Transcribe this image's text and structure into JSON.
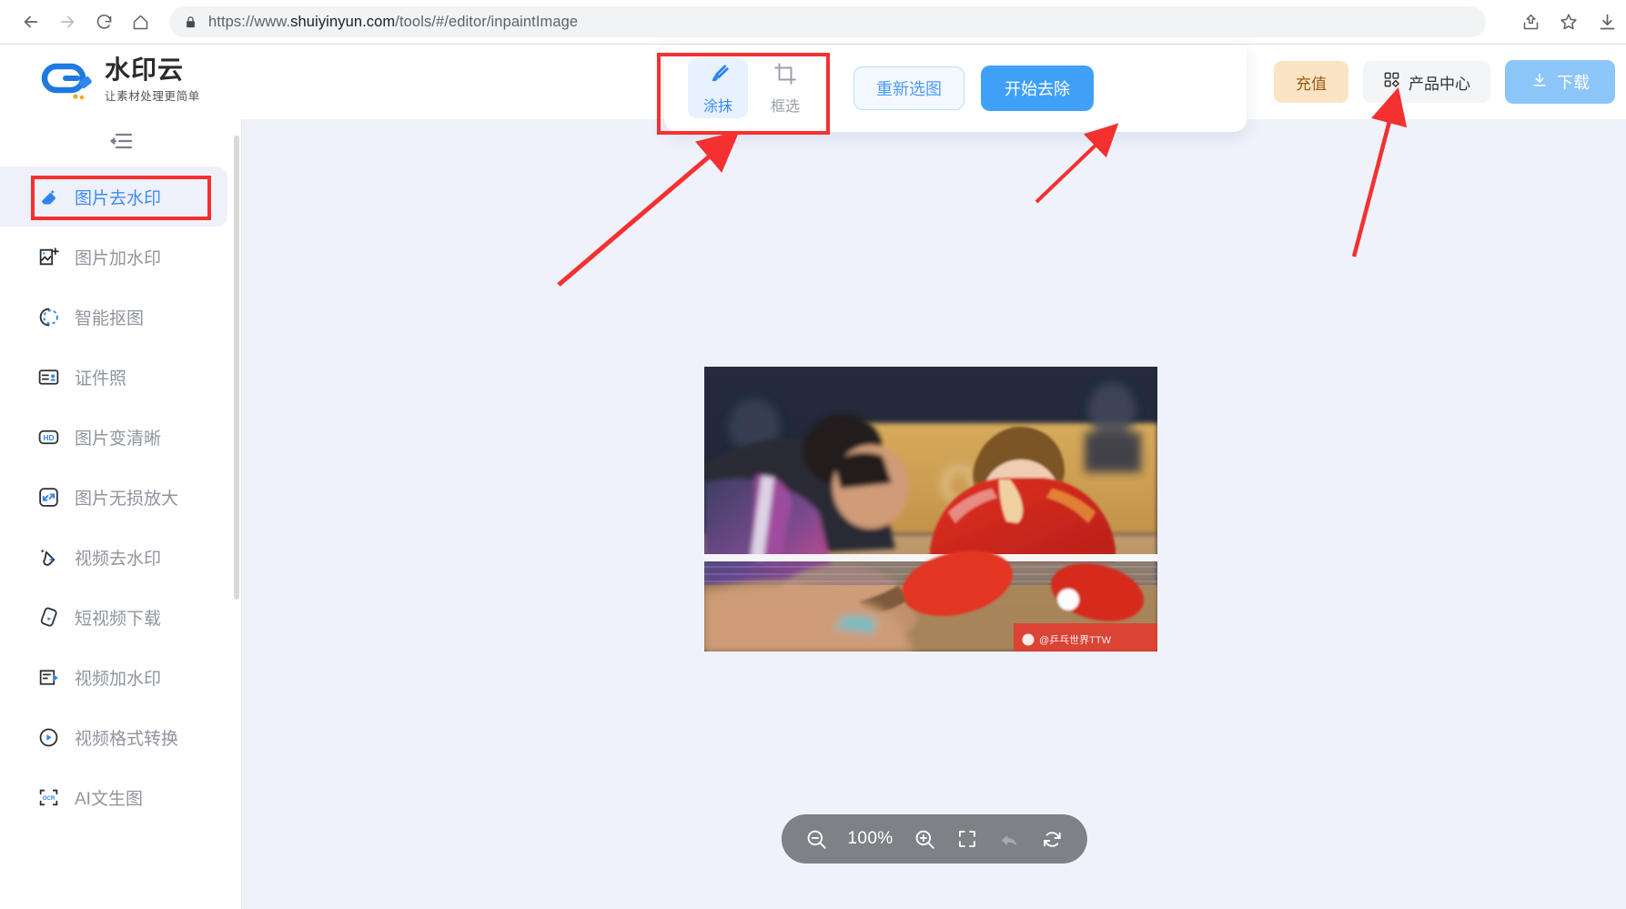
{
  "browser": {
    "url_prefix": "https://www.",
    "url_host": "shuiyinyun.com",
    "url_path": "/tools/#/editor/inpaintImage",
    "back_icon": "back-arrow-icon",
    "forward_icon": "forward-arrow-icon",
    "reload_icon": "reload-icon",
    "home_icon": "home-icon",
    "lock_icon": "lock-icon",
    "share_icon": "share-icon",
    "bookmark_icon": "star-icon",
    "downloads_icon": "download-icon"
  },
  "header": {
    "logo_title": "水印云",
    "logo_subtitle": "让素材处理更简单",
    "recharge_label": "充值",
    "product_center_label": "产品中心",
    "download_label": "下载"
  },
  "editor_toolbar": {
    "tools": [
      {
        "label": "涂抹",
        "icon": "brush-icon",
        "active": true
      },
      {
        "label": "框选",
        "icon": "crop-icon",
        "active": false
      }
    ],
    "reselect_label": "重新选图",
    "start_remove_label": "开始去除"
  },
  "sidebar": {
    "collapse_icon": "collapse-menu-icon",
    "items": [
      {
        "label": "图片去水印",
        "icon": "eraser-icon",
        "active": true
      },
      {
        "label": "图片加水印",
        "icon": "image-add-icon",
        "active": false
      },
      {
        "label": "智能抠图",
        "icon": "cutout-icon",
        "active": false
      },
      {
        "label": "证件照",
        "icon": "id-photo-icon",
        "active": false
      },
      {
        "label": "图片变清晰",
        "icon": "hd-icon",
        "active": false
      },
      {
        "label": "图片无损放大",
        "icon": "upscale-icon",
        "active": false
      },
      {
        "label": "视频去水印",
        "icon": "video-eraser-icon",
        "active": false
      },
      {
        "label": "短视频下载",
        "icon": "short-video-icon",
        "active": false
      },
      {
        "label": "视频加水印",
        "icon": "video-watermark-icon",
        "active": false
      },
      {
        "label": "视频格式转换",
        "icon": "video-convert-icon",
        "active": false
      },
      {
        "label": "AI文生图",
        "icon": "ocr-icon",
        "active": false
      }
    ]
  },
  "canvas": {
    "photo_watermark": "@乒乓世界TTW",
    "zoom_bar": {
      "zoom_out_icon": "zoom-out-icon",
      "zoom_level": "100%",
      "zoom_in_icon": "zoom-in-icon",
      "fit_screen_icon": "fullscreen-icon",
      "undo_icon": "undo-icon",
      "reset_icon": "reset-icon"
    }
  },
  "annotations": {
    "color": "#f53030",
    "highlight_boxes": [
      "editor-tool-group",
      "sidebar-active-item"
    ],
    "arrow_count": 3
  }
}
